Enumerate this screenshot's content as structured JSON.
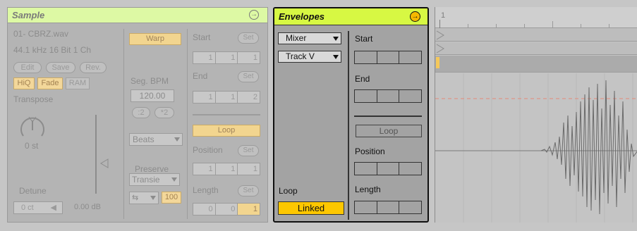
{
  "sample": {
    "title": "Sample",
    "file_name": "01- CBRZ.wav",
    "format": "44.1 kHz 16 Bit 1 Ch",
    "edit": "Edit",
    "save": "Save",
    "rev": "Rev.",
    "hiq": "HiQ",
    "fade": "Fade",
    "ram": "RAM",
    "transpose_label": "Transpose",
    "transpose_value": "0 st",
    "detune_label": "Detune",
    "detune_value": "0 ct",
    "volume_value": "0.00 dB",
    "warp": "Warp",
    "seg_bpm_label": "Seg. BPM",
    "seg_bpm_value": "120.00",
    "half": ":2",
    "double": "*2",
    "warp_mode": "Beats",
    "preserve_label": "Preserve",
    "preserve_value": "Transie",
    "loop_mode_value": "100",
    "start_label": "Start",
    "end_label": "End",
    "set_label": "Set",
    "start_values": [
      "1",
      "1",
      "1"
    ],
    "end_values": [
      "1",
      "1",
      "2"
    ],
    "loop_button": "Loop",
    "position_label": "Position",
    "position_values": [
      "1",
      "1",
      "1"
    ],
    "length_label": "Length",
    "length_values": [
      "0",
      "0",
      "1"
    ]
  },
  "envelopes": {
    "title": "Envelopes",
    "device_chooser": "Mixer",
    "control_chooser": "Track V",
    "start_label": "Start",
    "end_label": "End",
    "loop_button": "Loop",
    "position_label": "Position",
    "length_label": "Length",
    "loop_label": "Loop",
    "linked_button": "Linked"
  },
  "view": {
    "ruler_marker": "1"
  },
  "colors": {
    "sample_header": "#ddf9a4",
    "envelopes_header": "#d7f843",
    "linked_button": "#fdc700",
    "active_orange": "#f2d58f"
  },
  "icons": {
    "sample_header_icon": "circle-arrow-right",
    "envelopes_header_icon": "circle-arrow-right"
  }
}
